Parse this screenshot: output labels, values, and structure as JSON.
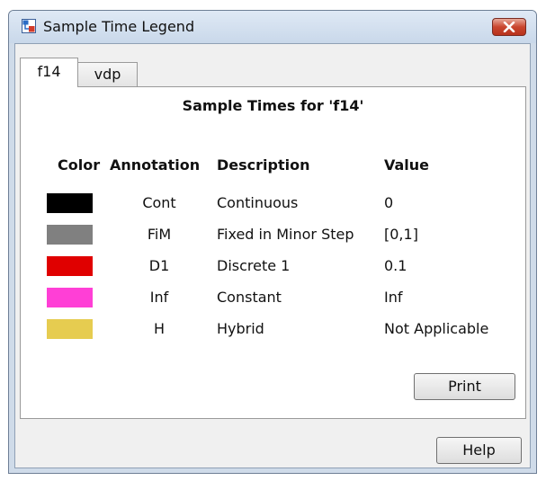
{
  "window": {
    "title": "Sample Time Legend",
    "icons": {
      "app": "simulink-app-icon",
      "close": "close-icon"
    },
    "close_color": "#c9452e"
  },
  "tabs": [
    {
      "label": "f14",
      "active": true
    },
    {
      "label": "vdp",
      "active": false
    }
  ],
  "panel": {
    "title": "Sample Times for 'f14'",
    "headers": {
      "color": "Color",
      "annotation": "Annotation",
      "description": "Description",
      "value": "Value"
    },
    "rows": [
      {
        "color": "#000000",
        "annotation": "Cont",
        "description": "Continuous",
        "value": "0"
      },
      {
        "color": "#808080",
        "annotation": "FiM",
        "description": "Fixed in Minor Step",
        "value": "[0,1]"
      },
      {
        "color": "#e00000",
        "annotation": "D1",
        "description": "Discrete 1",
        "value": "0.1"
      },
      {
        "color": "#ff3fd6",
        "annotation": "Inf",
        "description": "Constant",
        "value": "Inf"
      },
      {
        "color": "#e6cc50",
        "annotation": "H",
        "description": "Hybrid",
        "value": "Not Applicable"
      }
    ]
  },
  "buttons": {
    "print": "Print",
    "help": "Help"
  }
}
